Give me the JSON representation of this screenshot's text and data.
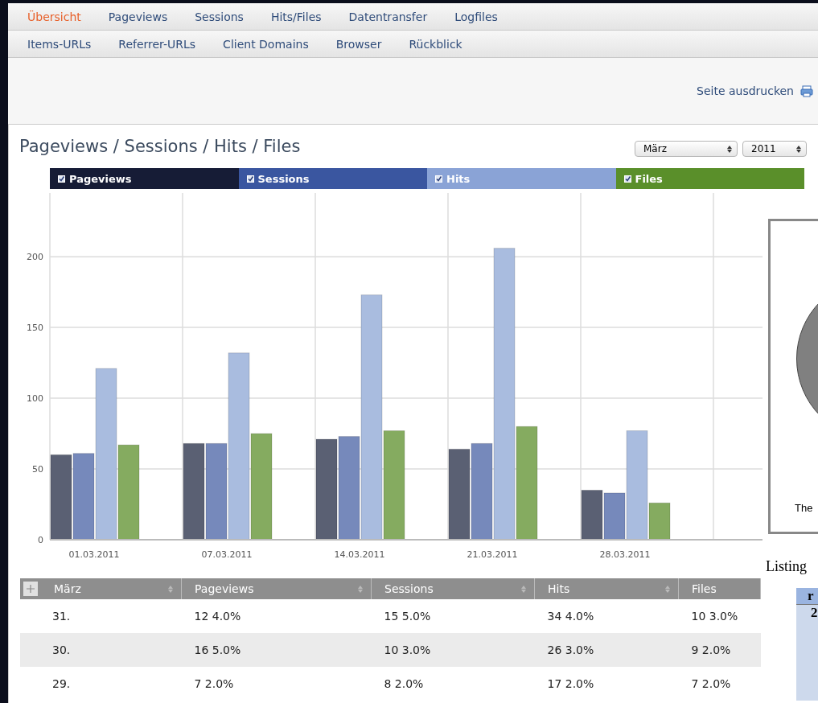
{
  "nav_rows": [
    [
      {
        "label": "Übersicht",
        "selected": true
      },
      {
        "label": "Pageviews",
        "selected": false
      },
      {
        "label": "Sessions",
        "selected": false
      },
      {
        "label": "Hits/Files",
        "selected": false
      },
      {
        "label": "Datentransfer",
        "selected": false
      },
      {
        "label": "Logfiles",
        "selected": false
      }
    ],
    [
      {
        "label": "Items-URLs",
        "selected": false
      },
      {
        "label": "Referrer-URLs",
        "selected": false
      },
      {
        "label": "Client Domains",
        "selected": false
      },
      {
        "label": "Browser",
        "selected": false
      },
      {
        "label": "Rückblick",
        "selected": false
      }
    ]
  ],
  "print_link": "Seite ausdrucken",
  "panel": {
    "title": "Pageviews / Sessions / Hits / Files",
    "month_select": "März",
    "year_select": "2011",
    "legend": [
      {
        "checked": true,
        "color": "#161c36"
      },
      {
        "checked": true,
        "color": "#3a56a0"
      },
      {
        "checked": true,
        "color": "#8aa3d6"
      },
      {
        "checked": true,
        "color": "#5a8f2a"
      }
    ],
    "chart_data": {
      "type": "bar",
      "grid": true,
      "categories": [
        "01.03.2011",
        "07.03.2011",
        "14.03.2011",
        "21.03.2011",
        "28.03.2011"
      ],
      "series": [
        {
          "name": "Pageviews",
          "color": "#5a6073",
          "values": [
            60,
            68,
            71,
            64,
            35
          ]
        },
        {
          "name": "Sessions",
          "color": "#7689bb",
          "values": [
            61,
            68,
            73,
            68,
            33
          ]
        },
        {
          "name": "Hits",
          "color": "#a9bcdf",
          "values": [
            121,
            132,
            173,
            206,
            77
          ]
        },
        {
          "name": "Files",
          "color": "#85ab60",
          "values": [
            67,
            75,
            77,
            80,
            26
          ]
        }
      ],
      "ylim": [
        0,
        245
      ],
      "yticks": [
        0,
        50,
        100,
        150,
        200
      ]
    },
    "table": {
      "columns": [
        "März",
        "Pageviews",
        "Sessions",
        "Hits",
        "Files"
      ],
      "rows": [
        [
          "31.",
          "12  4.0%",
          "15  5.0%",
          "34  4.0%",
          "10  3.0%"
        ],
        [
          "30.",
          "16  5.0%",
          "10  3.0%",
          "26  3.0%",
          "9  2.0%"
        ],
        [
          "29.",
          "7  2.0%",
          "8  2.0%",
          "17  2.0%",
          "7  2.0%"
        ]
      ]
    }
  },
  "overlay_window": {
    "caption": "The",
    "heading": "Listing",
    "table_header": "r",
    "table_cell": "2"
  }
}
